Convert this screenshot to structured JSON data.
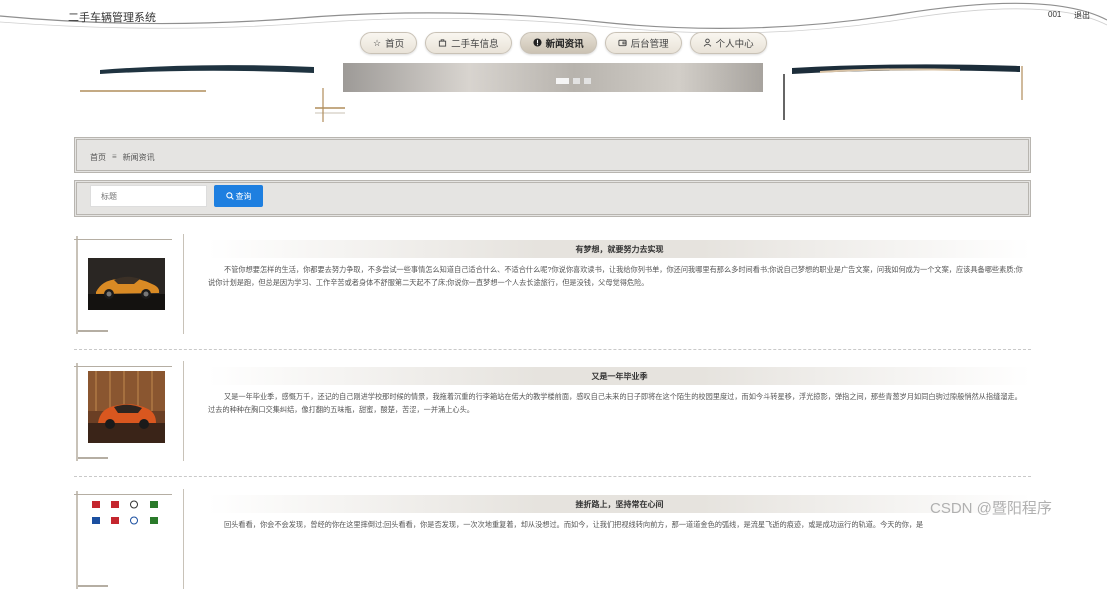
{
  "header": {
    "app_title": "二手车辆管理系统",
    "username": "001",
    "logout_label": "退出"
  },
  "nav": {
    "items": [
      {
        "label": "首页",
        "icon": "star-icon",
        "active": false
      },
      {
        "label": "二手车信息",
        "icon": "bag-icon",
        "active": false
      },
      {
        "label": "新闻资讯",
        "icon": "info-icon",
        "active": true
      },
      {
        "label": "后台管理",
        "icon": "wallet-icon",
        "active": false
      },
      {
        "label": "个人中心",
        "icon": "user-icon",
        "active": false
      }
    ]
  },
  "banner": {
    "slide_count": 3,
    "active_slide": 1
  },
  "breadcrumb": {
    "home": "首页",
    "separator": "≡",
    "current": "新闻资讯"
  },
  "search": {
    "placeholder": "标题",
    "value": "",
    "button_label": "查询",
    "button_color": "#1e7fe0"
  },
  "news": [
    {
      "title": "有梦想，就要努力去实现",
      "content": "不管你想要怎样的生活，你都要去努力争取，不多尝试一些事情怎么知道自己适合什么、不适合什么呢?你说你喜欢读书，让我给你列书单，你还问我哪里有那么多时间看书;你说自己梦想的职业是广告文案，问我如何成为一个文案，应该具备哪些素质;你说你计划是跑，但总是因为学习、工作辛苦或者身体不舒服第二天起不了床;你说你一直梦想一个人去长途旅行，但是没钱，父母觉得危险。",
      "image": "orange-sports-car"
    },
    {
      "title": "又是一年毕业季",
      "content": "又是一年毕业季，感慨万千，还记的自己刚进学校那时候的情景，我拖着沉重的行李箱站在偌大的教学楼前面，感叹自己未来的日子即将在这个陌生的校园里度过，而如今斗转星移，浮光掠影，弹指之间，那些青葱岁月如同白驹过隙般悄然从指缝溜走。过去的种种在胸口交集纠结，像打翻的五味瓶，甜蜜，酸楚，苦涩，一并涌上心头。",
      "image": "orange-suv"
    },
    {
      "title": "挫折路上，坚持常在心间",
      "content": "回头看看，你会不会发现，曾经的你在这里摔倒过;回头看看，你是否发现，一次次地重复着，却从没想过。而如今，让我们把视线转向前方，那一道道金色的弧线，是流星飞逝的痕迹，或是成功运行的轨道。今天的你，是",
      "image": "car-logos"
    }
  ],
  "watermark": "CSDN @暨阳程序"
}
